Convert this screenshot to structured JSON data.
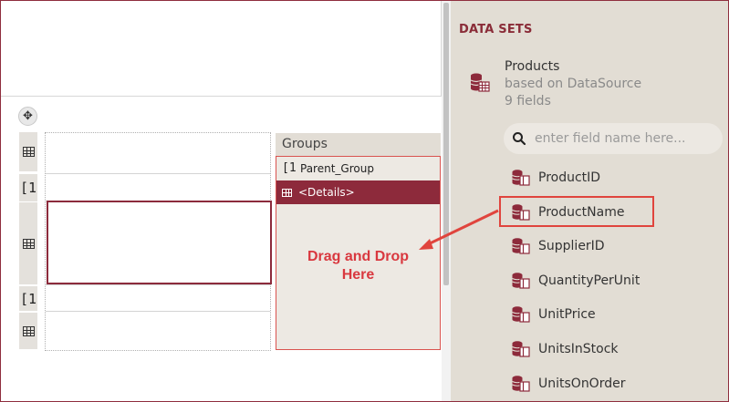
{
  "groups": {
    "title": "Groups",
    "items": [
      {
        "icon": "[1",
        "label": "Parent_Group"
      },
      {
        "icon": "grid",
        "label": "<Details>"
      }
    ],
    "drop_line1": "Drag and Drop",
    "drop_line2": "Here"
  },
  "row_handles": [
    "grid",
    "[1",
    "grid",
    "[1",
    "grid"
  ],
  "datasets": {
    "title": "DATA SETS",
    "name": "Products",
    "based_on": "based on DataSource",
    "field_count": "9 fields",
    "search_placeholder": "enter field name here...",
    "fields": [
      "ProductID",
      "ProductName",
      "SupplierID",
      "QuantityPerUnit",
      "UnitPrice",
      "UnitsInStock",
      "UnitsOnOrder"
    ],
    "highlighted_field": "ProductName"
  },
  "colors": {
    "accent": "#8d2a3b",
    "annotation": "#e0443d",
    "panel_bg": "#e2ddd4"
  }
}
